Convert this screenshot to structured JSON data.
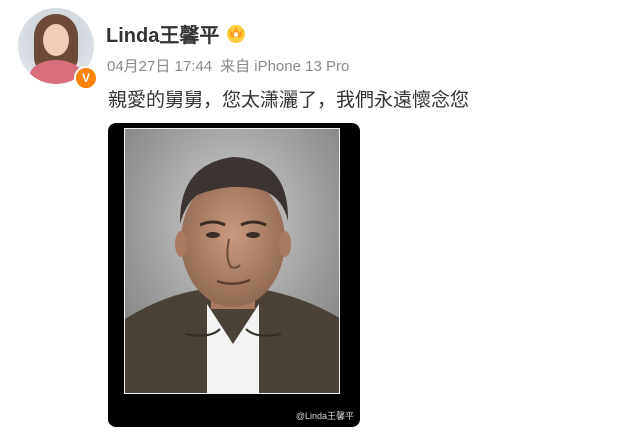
{
  "post": {
    "author": "Linda王馨平",
    "verified_badge": "V",
    "date": "04月27日 17:44",
    "source": "来自 iPhone 13 Pro",
    "text": "親愛的舅舅，您太潇灑了，我們永遠懷念您",
    "image": {
      "watermark": "@Linda王馨平"
    }
  },
  "colors": {
    "verified": "#ff8200",
    "username": "#333333",
    "meta": "#8a8a8a"
  },
  "icons": {
    "badge": "crown-icon",
    "verified": "verified-v-icon"
  }
}
